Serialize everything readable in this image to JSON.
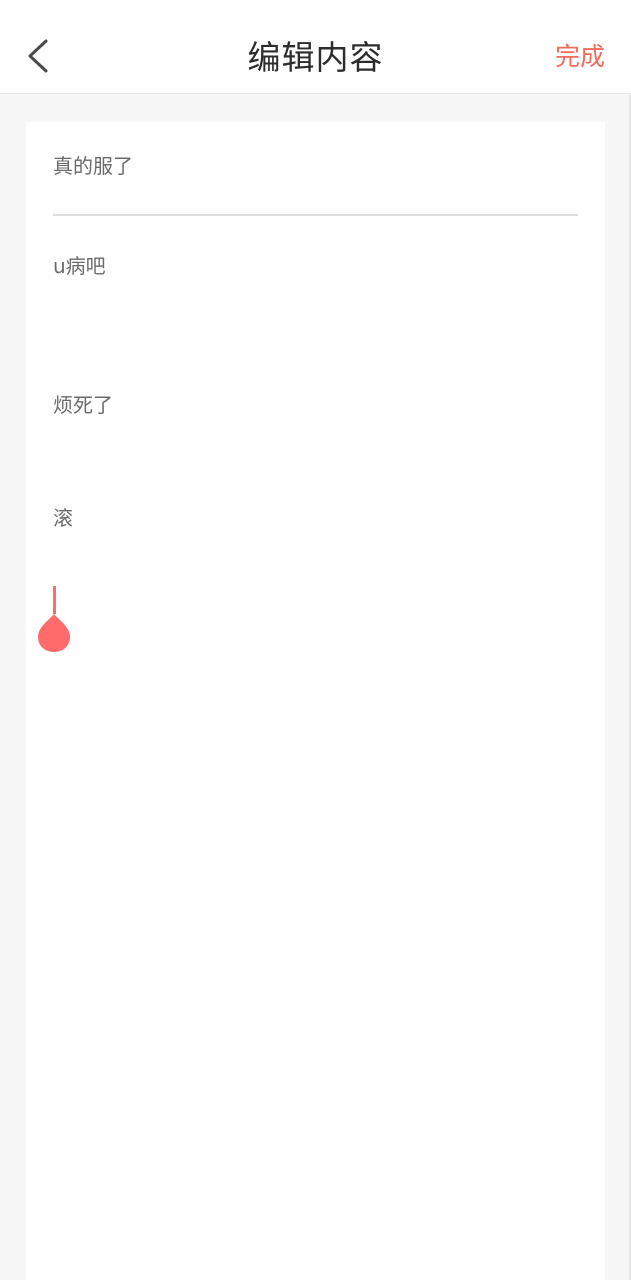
{
  "header": {
    "title": "编辑内容",
    "done_label": "完成",
    "back_icon": "chevron-left-icon"
  },
  "editor": {
    "title_value": "真的服了",
    "content_lines": [
      "u病吧",
      "烦死了",
      "滚"
    ]
  },
  "colors": {
    "accent": "#f26b5b",
    "cursor": "#ff6b6b",
    "background": "#f7f7f7",
    "surface": "#ffffff",
    "text_primary": "#2c2c2c",
    "text_secondary": "#6b6b6b",
    "divider": "#dedede"
  }
}
